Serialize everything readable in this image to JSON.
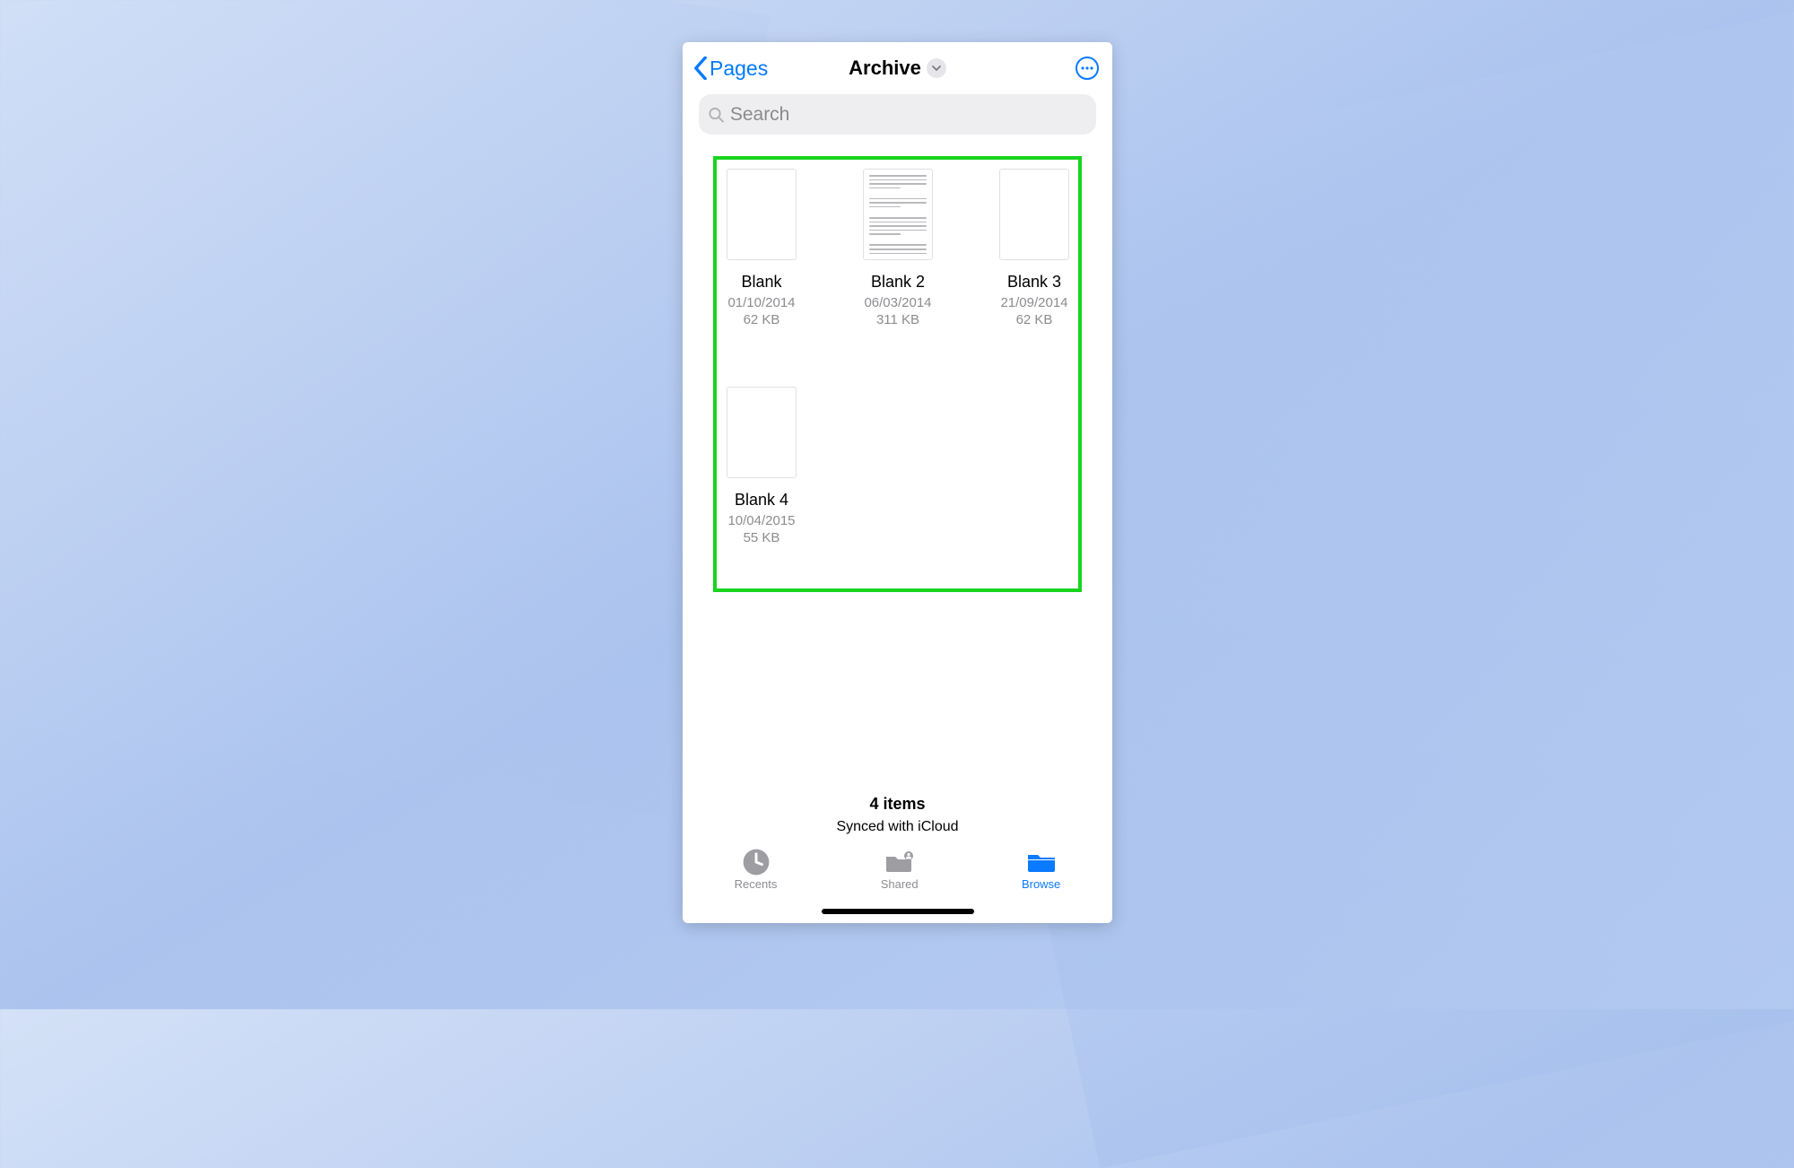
{
  "nav": {
    "back_label": "Pages",
    "title": "Archive"
  },
  "search": {
    "placeholder": "Search"
  },
  "documents": [
    {
      "name": "Blank",
      "date": "01/10/2014",
      "size": "62 KB",
      "has_content_preview": false
    },
    {
      "name": "Blank 2",
      "date": "06/03/2014",
      "size": "311 KB",
      "has_content_preview": true
    },
    {
      "name": "Blank 3",
      "date": "21/09/2014",
      "size": "62 KB",
      "has_content_preview": false
    },
    {
      "name": "Blank 4",
      "date": "10/04/2015",
      "size": "55 KB",
      "has_content_preview": false
    }
  ],
  "status": {
    "count_label": "4 items",
    "sync_label": "Synced with iCloud"
  },
  "tabs": {
    "recents": "Recents",
    "shared": "Shared",
    "browse": "Browse"
  },
  "colors": {
    "accent": "#007aff",
    "highlight": "#18d41f"
  }
}
